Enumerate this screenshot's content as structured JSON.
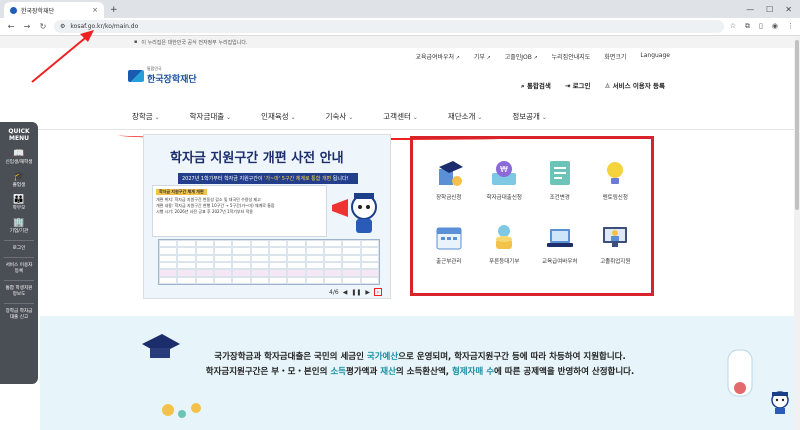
{
  "browser": {
    "tab_title": "한국장학재단",
    "tab_close": "×",
    "new_tab": "+",
    "url": "kosaf.go.kr/ko/main.do",
    "window_controls": [
      "—",
      "☐",
      "✕"
    ]
  },
  "gov_notice": "이 누리집은 대한민국 공식 전자정부 누리집입니다.",
  "utility_links": [
    "교육급여바우처",
    "기부",
    "고졸인JOB",
    "누리집안내지도",
    "화면크기",
    "Language"
  ],
  "logo": {
    "sub": "통합민국",
    "main": "한국장학재단"
  },
  "user_actions": [
    "통합검색",
    "로그인",
    "서비스 이용자 등록"
  ],
  "gnb": [
    "장학금",
    "학자금대출",
    "인재육성",
    "기숙사",
    "고객센터",
    "재단소개",
    "정보공개"
  ],
  "quick_menu": {
    "title": "QUICK MENU",
    "items": [
      "신입생/재학생",
      "졸업생",
      "학부모",
      "기업/기관"
    ],
    "extra": [
      "로그인",
      "서비스 이용자 등록",
      "통합 학생지원 정보도",
      "장학금 학자금대출 신고"
    ]
  },
  "banner": {
    "title": "학자금 지원구간 개편 사전 안내",
    "sub_prefix": "2027년 1학기부터 학자금 지원구간이",
    "sub_highlight": "'가~마' 5구간 체계로 통합 개편",
    "sub_suffix": "됩니다!",
    "box_heading": "학자금 지원구간 체계 개편",
    "box_lines": [
      "개편 취지: 학자금 지원구간 변동성 감소 및 대국민 수용성 제고",
      "개편 내용: 학자금 지원구간 현행 10구간 → 5구간(가~마) 체계로 통합",
      "시행 시기: 2026년 사전 공표 후 2027년 1학기부터 적용"
    ],
    "pager": {
      "current": "4/6",
      "prev": "◀",
      "pause": "❚❚",
      "next": "▶"
    }
  },
  "main_menu": [
    "장학금신청",
    "학자금대출신청",
    "조건변경",
    "멘토링신청",
    "출근부관리",
    "푸른등대기부",
    "교육급여바우처",
    "고졸취업지원"
  ],
  "hero": {
    "line1_a": "국가장학금과 학자금대출은 국민의 세금인 ",
    "line1_hl": "국가예산",
    "line1_b": "으로 운영되며, 학자금지원구간 등에 따라 차등하여 지원합니다.",
    "line2_a": "학자금지원구간은 부・모・본인의 ",
    "line2_hl1": "소득",
    "line2_b": "평가액과 ",
    "line2_hl2": "재산",
    "line2_c": "의 소득환산액, ",
    "line2_hl3": "형제자매 수",
    "line2_d": "에 따른 공제액을 반영하여 산정합니다."
  },
  "colors": {
    "accent": "#1a4f9c",
    "annotation_red": "#d8232a",
    "hero_bg": "#e7f4f9"
  }
}
